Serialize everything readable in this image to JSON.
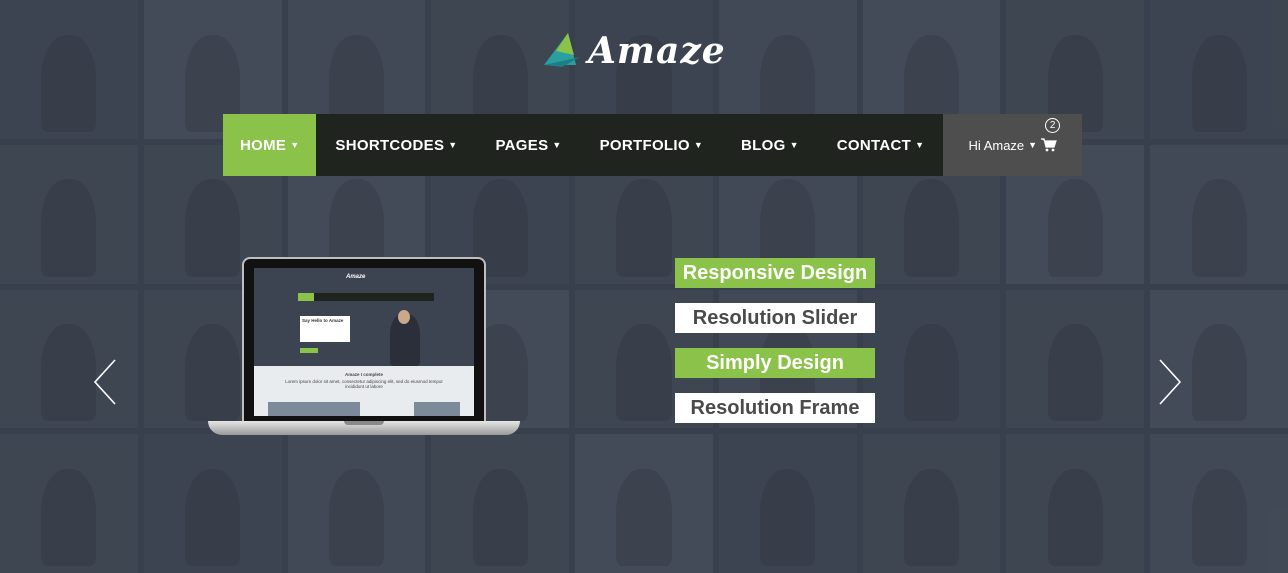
{
  "brand": {
    "name": "Amaze",
    "accent": "#8bc34a",
    "nav_bg": "#1f241f"
  },
  "nav": {
    "items": [
      {
        "label": "HOME",
        "active": true
      },
      {
        "label": "SHORTCODES",
        "active": false
      },
      {
        "label": "PAGES",
        "active": false
      },
      {
        "label": "PORTFOLIO",
        "active": false
      },
      {
        "label": "BLOG",
        "active": false
      },
      {
        "label": "CONTACT",
        "active": false
      }
    ],
    "user_label": "Hi Amaze",
    "cart_count": "2",
    "cart_icon": "cart-icon"
  },
  "slider": {
    "prev_icon": "chevron-left-icon",
    "next_icon": "chevron-right-icon",
    "features": [
      {
        "label": "Responsive Design",
        "style": "green"
      },
      {
        "label": "Resolution Slider",
        "style": "white"
      },
      {
        "label": "Simply Design",
        "style": "green"
      },
      {
        "label": "Resolution Frame",
        "style": "white"
      }
    ]
  },
  "mockup": {
    "logo": "Amaze",
    "hero_text": "Say Hello to Amaze",
    "section_title": "Amaze I complete",
    "body_text": "Lorem ipsum dolor sit amet, consectetur adipiscing elit, sed do eiusmod tempor incididunt ut labore"
  }
}
